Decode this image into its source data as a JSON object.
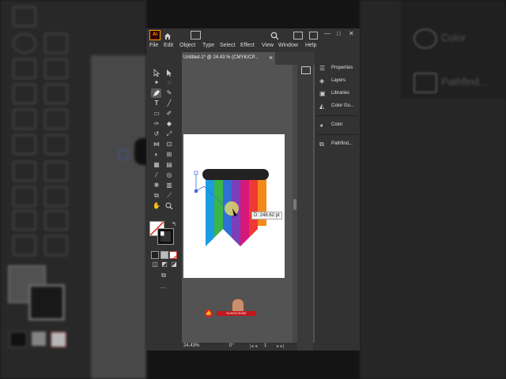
{
  "app": {
    "logo": "Ai",
    "accent_color": "#ff9a00",
    "window_controls": [
      "—",
      "□",
      "✕"
    ]
  },
  "menu": [
    "File",
    "Edit",
    "Object",
    "Type",
    "Select",
    "Effect",
    "View",
    "Window",
    "Help"
  ],
  "document": {
    "tab_title": "Untitled-1* @ 24.43 % (CMYK/CP...",
    "tab_close": "×",
    "zoom": "24.43%",
    "rotation": "0°",
    "artboard": "1"
  },
  "canvas": {
    "measure_tooltip": "D: 248.62 pt",
    "stripe_colors": [
      "#1b9de2",
      "#3ab54a",
      "#2f6fd6",
      "#7b3fb8",
      "#d6187b",
      "#ee3a33",
      "#f28a1b"
    ],
    "subscribe_label": "SUBSCRIBE"
  },
  "panels": [
    {
      "icon": "properties-icon",
      "label": "Properties"
    },
    {
      "icon": "layers-icon",
      "label": "Layers"
    },
    {
      "icon": "libraries-icon",
      "label": "Libraries"
    },
    {
      "icon": "color-guide-icon",
      "label": "Color Gu..."
    },
    {
      "icon": "color-icon",
      "label": "Color"
    },
    {
      "icon": "pathfinder-icon",
      "label": "Pathfind..."
    }
  ],
  "background_panels": {
    "color": "Color",
    "pathfinder": "Pathfind..."
  }
}
